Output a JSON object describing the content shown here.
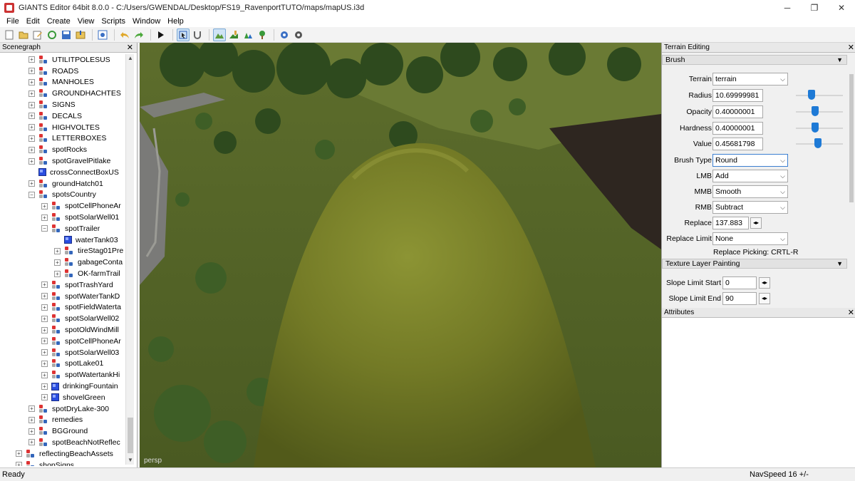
{
  "window": {
    "title": "GIANTS Editor 64bit 8.0.0 - C:/Users/GWENDAL/Desktop/FS19_RavenportTUTO/maps/mapUS.i3d",
    "minimize": "─",
    "maximize": "❐",
    "close": "✕"
  },
  "menu": [
    "File",
    "Edit",
    "Create",
    "View",
    "Scripts",
    "Window",
    "Help"
  ],
  "toolbar": {
    "icons": [
      "new-icon",
      "open-icon",
      "edit-icon",
      "refresh-icon",
      "save-icon",
      "import-icon",
      "export-icon",
      "undo-icon",
      "redo-icon",
      "play-icon",
      "select-icon",
      "magnet-icon",
      "terrain-sculpt-icon",
      "terrain-paint-icon",
      "foliage-icon",
      "tree-paint-icon",
      "settings-icon",
      "settings-alt-icon"
    ]
  },
  "scenegraph": {
    "title": "Scenegraph",
    "close": "✕",
    "scroll_up": "▲",
    "scroll_down": "▼",
    "nodes": [
      {
        "label": "UTILITPOLESUS",
        "depth": 1,
        "expander": "+",
        "icon": "tg"
      },
      {
        "label": "ROADS",
        "depth": 1,
        "expander": "+",
        "icon": "tg"
      },
      {
        "label": "MANHOLES",
        "depth": 1,
        "expander": "+",
        "icon": "tg"
      },
      {
        "label": "GROUNDHACHTES",
        "depth": 1,
        "expander": "+",
        "icon": "tg"
      },
      {
        "label": "SIGNS",
        "depth": 1,
        "expander": "+",
        "icon": "tg"
      },
      {
        "label": "DECALS",
        "depth": 1,
        "expander": "+",
        "icon": "tg"
      },
      {
        "label": "HIGHVOLTES",
        "depth": 1,
        "expander": "+",
        "icon": "tg"
      },
      {
        "label": "LETTERBOXES",
        "depth": 1,
        "expander": "+",
        "icon": "tg"
      },
      {
        "label": "spotRocks",
        "depth": 1,
        "expander": "+",
        "icon": "tg"
      },
      {
        "label": "spotGravelPitlake",
        "depth": 1,
        "expander": "+",
        "icon": "tg"
      },
      {
        "label": "crossConnectBoxUS",
        "depth": 1,
        "expander": "",
        "icon": "cube"
      },
      {
        "label": "groundHatch01",
        "depth": 1,
        "expander": "+",
        "icon": "tg"
      },
      {
        "label": "spotsCountry",
        "depth": 1,
        "expander": "−",
        "icon": "tg"
      },
      {
        "label": "spotCellPhoneAr",
        "depth": 2,
        "expander": "+",
        "icon": "tg"
      },
      {
        "label": "spotSolarWell01",
        "depth": 2,
        "expander": "+",
        "icon": "tg"
      },
      {
        "label": "spotTrailer",
        "depth": 2,
        "expander": "−",
        "icon": "tg"
      },
      {
        "label": "waterTank03",
        "depth": 3,
        "expander": "",
        "icon": "cube"
      },
      {
        "label": "tireStag01Pre",
        "depth": 3,
        "expander": "+",
        "icon": "tg"
      },
      {
        "label": "gabageConta",
        "depth": 3,
        "expander": "+",
        "icon": "tg"
      },
      {
        "label": "OK-farmTrail",
        "depth": 3,
        "expander": "+",
        "icon": "tg"
      },
      {
        "label": "spotTrashYard",
        "depth": 2,
        "expander": "+",
        "icon": "tg"
      },
      {
        "label": "spotWaterTankD",
        "depth": 2,
        "expander": "+",
        "icon": "tg"
      },
      {
        "label": "spotFieldWaterta",
        "depth": 2,
        "expander": "+",
        "icon": "tg"
      },
      {
        "label": "spotSolarWell02",
        "depth": 2,
        "expander": "+",
        "icon": "tg"
      },
      {
        "label": "spotOldWindMill",
        "depth": 2,
        "expander": "+",
        "icon": "tg"
      },
      {
        "label": "spotCellPhoneAr",
        "depth": 2,
        "expander": "+",
        "icon": "tg"
      },
      {
        "label": "spotSolarWell03",
        "depth": 2,
        "expander": "+",
        "icon": "tg"
      },
      {
        "label": "spotLake01",
        "depth": 2,
        "expander": "+",
        "icon": "tg"
      },
      {
        "label": "spotWatertankHi",
        "depth": 2,
        "expander": "+",
        "icon": "tg"
      },
      {
        "label": "drinkingFountain",
        "depth": 2,
        "expander": "+",
        "icon": "cube"
      },
      {
        "label": "shovelGreen",
        "depth": 2,
        "expander": "+",
        "icon": "cube"
      },
      {
        "label": "spotDryLake-300",
        "depth": 1,
        "expander": "+",
        "icon": "tg"
      },
      {
        "label": "remedies",
        "depth": 1,
        "expander": "+",
        "icon": "tg"
      },
      {
        "label": "BGGround",
        "depth": 1,
        "expander": "+",
        "icon": "tg"
      },
      {
        "label": "spotBeachNotReflec",
        "depth": 1,
        "expander": "+",
        "icon": "tg"
      },
      {
        "label": "reflectingBeachAssets",
        "depth": 0,
        "expander": "+",
        "icon": "tg"
      },
      {
        "label": "shopSigns",
        "depth": 0,
        "expander": "+",
        "icon": "tg"
      }
    ]
  },
  "viewport": {
    "camera_label": "persp"
  },
  "terrain_editing": {
    "title": "Terrain Editing",
    "close": "✕",
    "brush_section": "Brush",
    "texture_section": "Texture Layer Painting",
    "collapse_caret": "▼",
    "terrain": {
      "label": "Terrain",
      "value": "terrain"
    },
    "radius": {
      "label": "Radius",
      "value": "10.69999981",
      "level": 0.3
    },
    "opacity": {
      "label": "Opacity",
      "value": "0.40000001",
      "level": 0.4
    },
    "hardness": {
      "label": "Hardness",
      "value": "0.40000001",
      "level": 0.4
    },
    "value": {
      "label": "Value",
      "value": "0.45681798",
      "level": 0.46
    },
    "brush_type": {
      "label": "Brush Type",
      "value": "Round"
    },
    "lmb": {
      "label": "LMB",
      "value": "Add"
    },
    "mmb": {
      "label": "MMB",
      "value": "Smooth"
    },
    "rmb": {
      "label": "RMB",
      "value": "Subtract"
    },
    "replace": {
      "label": "Replace",
      "value": "137.883"
    },
    "replace_limit": {
      "label": "Replace Limit",
      "value": "None"
    },
    "replace_picking": "Replace Picking: CRTL-R",
    "slope_start": {
      "label": "Slope Limit Start",
      "value": "0"
    },
    "slope_end": {
      "label": "Slope Limit End",
      "value": "90"
    },
    "dropdown_glyph": "⌵",
    "stepper_glyph": "◂▸"
  },
  "attributes": {
    "title": "Attributes",
    "close": "✕"
  },
  "status": {
    "left": "Ready",
    "right": "NavSpeed 16 +/-"
  },
  "colors": {
    "accent": "#1e7ad6",
    "grass": "#6b7a2a",
    "mound": "#7f8a2e"
  }
}
